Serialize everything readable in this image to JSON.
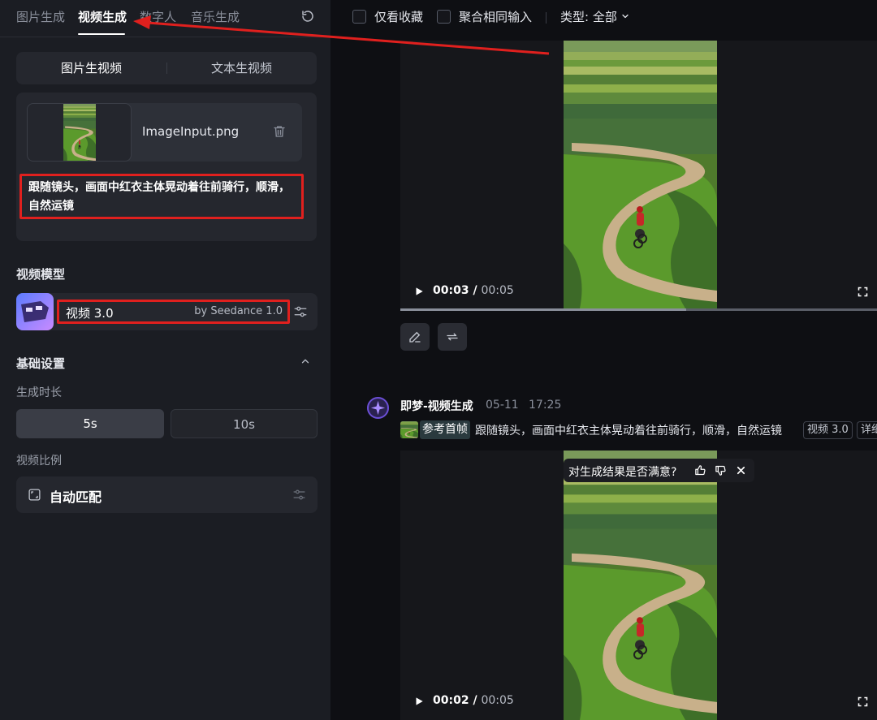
{
  "left_panel": {
    "tabs": [
      {
        "label": "图片生成"
      },
      {
        "label": "视频生成"
      },
      {
        "label": "数字人"
      },
      {
        "label": "音乐生成"
      }
    ],
    "mode_tabs": [
      {
        "label": "图片生视频"
      },
      {
        "label": "文本生视频"
      }
    ],
    "input": {
      "file_name": "ImageInput.png",
      "prompt": "跟随镜头，画面中红衣主体晃动着往前骑行，顺滑，自然运镜"
    },
    "model": {
      "section_title": "视频模型",
      "name": "视频 3.0",
      "by": "by Seedance 1.0"
    },
    "basic": {
      "section_title": "基础设置",
      "duration_label": "生成时长",
      "durations": [
        {
          "label": "5s"
        },
        {
          "label": "10s"
        }
      ],
      "ratio_label": "视频比例",
      "ratio_value": "自动匹配"
    }
  },
  "topbar": {
    "fav_only": "仅看收藏",
    "merge_same": "聚合相同输入",
    "type_filter": "类型: 全部"
  },
  "feed": {
    "video1": {
      "current": "00:03",
      "total": "00:05",
      "progress": 0.6
    },
    "generation": {
      "name": "即梦-视频生成",
      "date": "05-11",
      "time": "17:25",
      "ref_tag": "参考首帧",
      "prompt": "跟随镜头，画面中红衣主体晃动着往前骑行，顺滑，自然运镜",
      "model_tag": "视频 3.0",
      "detail_tag": "详细"
    },
    "feedback_question": "对生成结果是否满意?",
    "video2": {
      "current": "00:02",
      "total": "00:05"
    }
  },
  "colors": {
    "highlight": "#e0201e",
    "accent_purple": "#6b4fd6",
    "field_green": "#5a8a2a",
    "path_tan": "#c8b08a",
    "rider_red": "#c62828"
  }
}
